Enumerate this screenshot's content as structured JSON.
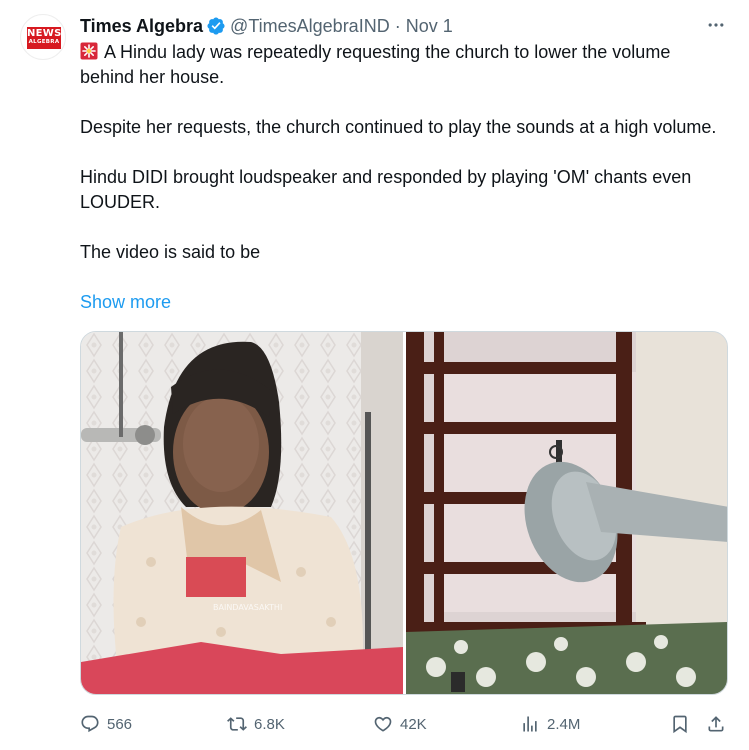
{
  "account": {
    "avatar_line1": "NEWS",
    "avatar_line2": "ALGEBRA",
    "display_name": "Times Algebra",
    "handle": "@TimesAlgebraIND",
    "separator": "·",
    "time": "Nov 1"
  },
  "tweet": {
    "paragraphs": [
      "A Hindu lady was repeatedly requesting the church to lower the volume behind her house.",
      "Despite her requests, the church continued to play the sounds at a high volume.",
      "Hindu DIDI brought loudspeaker and responded by playing 'OM' chants even LOUDER.",
      "The video is said to be"
    ],
    "show_more": "Show more",
    "media_watermark": "BAINDAVASAKTHI"
  },
  "actions": {
    "replies": "566",
    "reposts": "6.8K",
    "likes": "42K",
    "views": "2.4M"
  },
  "colors": {
    "accent": "#1d9bf0",
    "muted": "#536471",
    "text": "#0f1419",
    "brand_red": "#d71920"
  },
  "icons": [
    "siren-icon",
    "verified-badge-icon",
    "more-icon",
    "reply-icon",
    "repost-icon",
    "like-icon",
    "views-icon",
    "bookmark-icon",
    "share-icon"
  ]
}
